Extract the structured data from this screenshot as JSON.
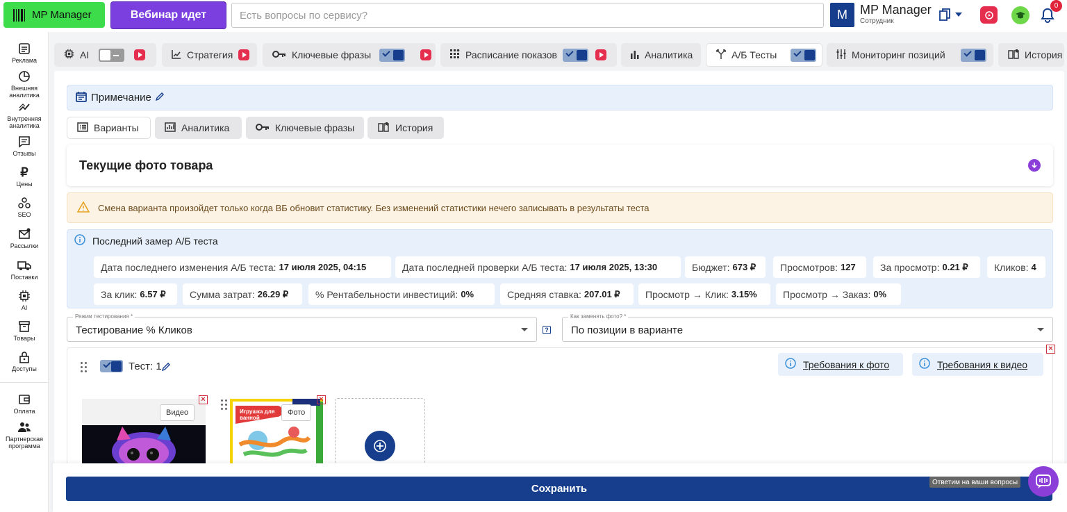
{
  "topbar": {
    "logo_label": "MP Manager",
    "webinar_label": "Вебинар идет",
    "search_placeholder": "Есть вопросы по сервису?",
    "avatar_letter": "M",
    "user_name": "MP Manager",
    "user_role": "Сотрудник",
    "notifications_count": "0",
    "accent_color": "#163e8c"
  },
  "sidebar": {
    "items": [
      {
        "label": "Реклама",
        "icon": "ad-icon"
      },
      {
        "label": "Внешняя аналитика",
        "icon": "pie-chart-icon"
      },
      {
        "label": "Внутренняя аналитика",
        "icon": "trend-icon"
      },
      {
        "label": "Отзывы",
        "icon": "comment-icon"
      },
      {
        "label": "Цены",
        "icon": "ruble-icon"
      },
      {
        "label": "SEO",
        "icon": "seo-icon"
      },
      {
        "label": "Рассылки",
        "icon": "mail-icon"
      },
      {
        "label": "Поставки",
        "icon": "truck-icon"
      },
      {
        "label": "AI",
        "icon": "chip-icon"
      },
      {
        "label": "Товары",
        "icon": "box-icon"
      },
      {
        "label": "Доступы",
        "icon": "lock-icon"
      },
      {
        "label": "Оплата",
        "icon": "wallet-icon"
      },
      {
        "label": "Партнерская программа",
        "icon": "partners-icon"
      }
    ]
  },
  "tabs": [
    {
      "label": "AI",
      "toggle": "off",
      "video": true
    },
    {
      "label": "Стратегия",
      "toggle": "none",
      "video": true
    },
    {
      "label": "Ключевые фразы",
      "toggle": "on",
      "video": true
    },
    {
      "label": "Расписание показов",
      "toggle": "on",
      "video": true
    },
    {
      "label": "Аналитика",
      "toggle": "none",
      "video": false
    },
    {
      "label": "А/Б Тесты",
      "toggle": "on",
      "video": false
    },
    {
      "label": "Мониторинг позиций",
      "toggle": "on",
      "video": false
    },
    {
      "label": "История",
      "toggle": "none",
      "video": false
    }
  ],
  "note": {
    "label": "Примечание"
  },
  "subtabs": [
    {
      "label": "Варианты"
    },
    {
      "label": "Аналитика"
    },
    {
      "label": "Ключевые фразы"
    },
    {
      "label": "История"
    }
  ],
  "photo_card": {
    "title": "Текущие фото товара"
  },
  "warning": {
    "text": "Смена варианта произойдет только когда ВБ обновит статистику. Без изменений статистики нечего записывать в результаты теста"
  },
  "last_measure": {
    "title": "Последний замер А/Б теста",
    "chips": [
      {
        "label": "Дата последнего изменения А/Б теста:",
        "value": "17 июля 2025, 04:15"
      },
      {
        "label": "Дата последней проверки А/Б теста:",
        "value": "17 июля 2025, 13:30"
      },
      {
        "label": "Бюджет:",
        "value": "673 ₽"
      },
      {
        "label": "Просмотров:",
        "value": "127"
      },
      {
        "label": "За просмотр:",
        "value": "0.21 ₽"
      },
      {
        "label": "Кликов:",
        "value": "4"
      },
      {
        "label": "За клик:",
        "value": "6.57 ₽"
      },
      {
        "label": "Сумма затрат:",
        "value": "26.29 ₽"
      },
      {
        "label": "% Рентабельности инвестиций:",
        "value": "0%"
      },
      {
        "label": "Средняя ставка:",
        "value": "207.01 ₽"
      },
      {
        "label": "Просмотр → Клик:",
        "value": "3.15%"
      },
      {
        "label": "Просмотр → Заказ:",
        "value": "0%"
      }
    ]
  },
  "mode_select": {
    "label": "Режим тестирования *",
    "value": "Тестирование % Кликов"
  },
  "help_label": "?",
  "photo_select": {
    "label": "Как заменять фото? *",
    "value": "По позиции в варианте"
  },
  "test": {
    "title": "Тест: 1",
    "toggle": "on",
    "req_photo": "Требования к фото",
    "req_video": "Требования к видео",
    "video_tag": "Видео",
    "photo_tag": "Фото",
    "product_caption": "Игрушка для ванной"
  },
  "save_label": "Сохранить",
  "chat_tooltip": "Ответим на ваши вопросы"
}
